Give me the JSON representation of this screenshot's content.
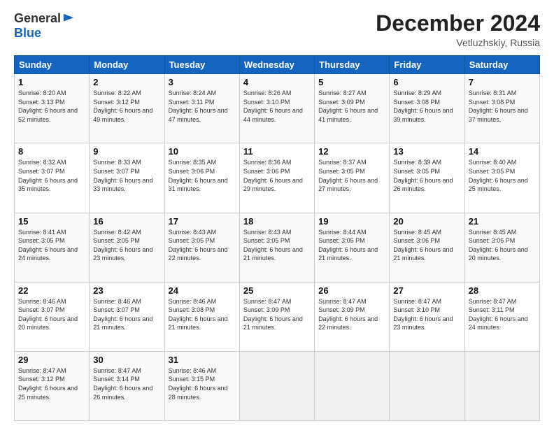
{
  "header": {
    "logo_general": "General",
    "logo_blue": "Blue",
    "month_title": "December 2024",
    "location": "Vetluzhskiy, Russia"
  },
  "days_of_week": [
    "Sunday",
    "Monday",
    "Tuesday",
    "Wednesday",
    "Thursday",
    "Friday",
    "Saturday"
  ],
  "weeks": [
    [
      {
        "day": 1,
        "sunrise": "8:20 AM",
        "sunset": "3:13 PM",
        "daylight": "6 hours and 52 minutes."
      },
      {
        "day": 2,
        "sunrise": "8:22 AM",
        "sunset": "3:12 PM",
        "daylight": "6 hours and 49 minutes."
      },
      {
        "day": 3,
        "sunrise": "8:24 AM",
        "sunset": "3:11 PM",
        "daylight": "6 hours and 47 minutes."
      },
      {
        "day": 4,
        "sunrise": "8:26 AM",
        "sunset": "3:10 PM",
        "daylight": "6 hours and 44 minutes."
      },
      {
        "day": 5,
        "sunrise": "8:27 AM",
        "sunset": "3:09 PM",
        "daylight": "6 hours and 41 minutes."
      },
      {
        "day": 6,
        "sunrise": "8:29 AM",
        "sunset": "3:08 PM",
        "daylight": "6 hours and 39 minutes."
      },
      {
        "day": 7,
        "sunrise": "8:31 AM",
        "sunset": "3:08 PM",
        "daylight": "6 hours and 37 minutes."
      }
    ],
    [
      {
        "day": 8,
        "sunrise": "8:32 AM",
        "sunset": "3:07 PM",
        "daylight": "6 hours and 35 minutes."
      },
      {
        "day": 9,
        "sunrise": "8:33 AM",
        "sunset": "3:07 PM",
        "daylight": "6 hours and 33 minutes."
      },
      {
        "day": 10,
        "sunrise": "8:35 AM",
        "sunset": "3:06 PM",
        "daylight": "6 hours and 31 minutes."
      },
      {
        "day": 11,
        "sunrise": "8:36 AM",
        "sunset": "3:06 PM",
        "daylight": "6 hours and 29 minutes."
      },
      {
        "day": 12,
        "sunrise": "8:37 AM",
        "sunset": "3:05 PM",
        "daylight": "6 hours and 27 minutes."
      },
      {
        "day": 13,
        "sunrise": "8:39 AM",
        "sunset": "3:05 PM",
        "daylight": "6 hours and 26 minutes."
      },
      {
        "day": 14,
        "sunrise": "8:40 AM",
        "sunset": "3:05 PM",
        "daylight": "6 hours and 25 minutes."
      }
    ],
    [
      {
        "day": 15,
        "sunrise": "8:41 AM",
        "sunset": "3:05 PM",
        "daylight": "6 hours and 24 minutes."
      },
      {
        "day": 16,
        "sunrise": "8:42 AM",
        "sunset": "3:05 PM",
        "daylight": "6 hours and 23 minutes."
      },
      {
        "day": 17,
        "sunrise": "8:43 AM",
        "sunset": "3:05 PM",
        "daylight": "6 hours and 22 minutes."
      },
      {
        "day": 18,
        "sunrise": "8:43 AM",
        "sunset": "3:05 PM",
        "daylight": "6 hours and 21 minutes."
      },
      {
        "day": 19,
        "sunrise": "8:44 AM",
        "sunset": "3:05 PM",
        "daylight": "6 hours and 21 minutes."
      },
      {
        "day": 20,
        "sunrise": "8:45 AM",
        "sunset": "3:06 PM",
        "daylight": "6 hours and 21 minutes."
      },
      {
        "day": 21,
        "sunrise": "8:45 AM",
        "sunset": "3:06 PM",
        "daylight": "6 hours and 20 minutes."
      }
    ],
    [
      {
        "day": 22,
        "sunrise": "8:46 AM",
        "sunset": "3:07 PM",
        "daylight": "6 hours and 20 minutes."
      },
      {
        "day": 23,
        "sunrise": "8:46 AM",
        "sunset": "3:07 PM",
        "daylight": "6 hours and 21 minutes."
      },
      {
        "day": 24,
        "sunrise": "8:46 AM",
        "sunset": "3:08 PM",
        "daylight": "6 hours and 21 minutes."
      },
      {
        "day": 25,
        "sunrise": "8:47 AM",
        "sunset": "3:09 PM",
        "daylight": "6 hours and 21 minutes."
      },
      {
        "day": 26,
        "sunrise": "8:47 AM",
        "sunset": "3:09 PM",
        "daylight": "6 hours and 22 minutes."
      },
      {
        "day": 27,
        "sunrise": "8:47 AM",
        "sunset": "3:10 PM",
        "daylight": "6 hours and 23 minutes."
      },
      {
        "day": 28,
        "sunrise": "8:47 AM",
        "sunset": "3:11 PM",
        "daylight": "6 hours and 24 minutes."
      }
    ],
    [
      {
        "day": 29,
        "sunrise": "8:47 AM",
        "sunset": "3:12 PM",
        "daylight": "6 hours and 25 minutes."
      },
      {
        "day": 30,
        "sunrise": "8:47 AM",
        "sunset": "3:14 PM",
        "daylight": "6 hours and 26 minutes."
      },
      {
        "day": 31,
        "sunrise": "8:46 AM",
        "sunset": "3:15 PM",
        "daylight": "6 hours and 28 minutes."
      },
      null,
      null,
      null,
      null
    ]
  ]
}
